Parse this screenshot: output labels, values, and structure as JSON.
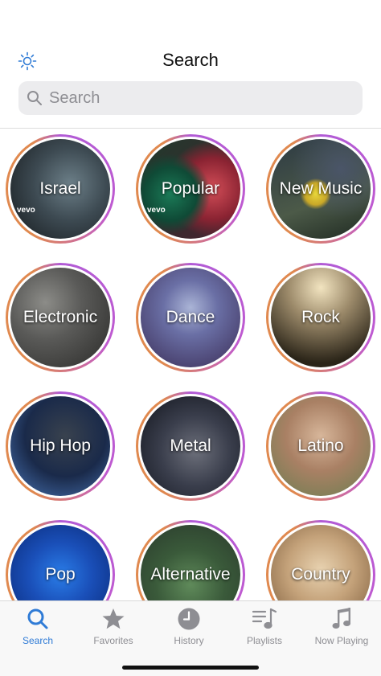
{
  "header": {
    "title": "Search",
    "search_placeholder": "Search"
  },
  "genres": [
    {
      "label": "Israel"
    },
    {
      "label": "Popular"
    },
    {
      "label": "New Music"
    },
    {
      "label": "Electronic"
    },
    {
      "label": "Dance"
    },
    {
      "label": "Rock"
    },
    {
      "label": "Hip Hop"
    },
    {
      "label": "Metal"
    },
    {
      "label": "Latino"
    },
    {
      "label": "Pop"
    },
    {
      "label": "Alternative"
    },
    {
      "label": "Country"
    }
  ],
  "badges": {
    "vevo": "vevo"
  },
  "tabbar": {
    "items": [
      {
        "label": "Search",
        "icon": "search-icon",
        "active": true
      },
      {
        "label": "Favorites",
        "icon": "star-icon",
        "active": false
      },
      {
        "label": "History",
        "icon": "clock-icon",
        "active": false
      },
      {
        "label": "Playlists",
        "icon": "playlist-icon",
        "active": false
      },
      {
        "label": "Now Playing",
        "icon": "music-note-icon",
        "active": false
      }
    ]
  },
  "colors": {
    "accent": "#2f7bd6",
    "inactive": "#8e8e93",
    "ring_purple": "#b15bd6",
    "ring_orange": "#e0894f"
  }
}
